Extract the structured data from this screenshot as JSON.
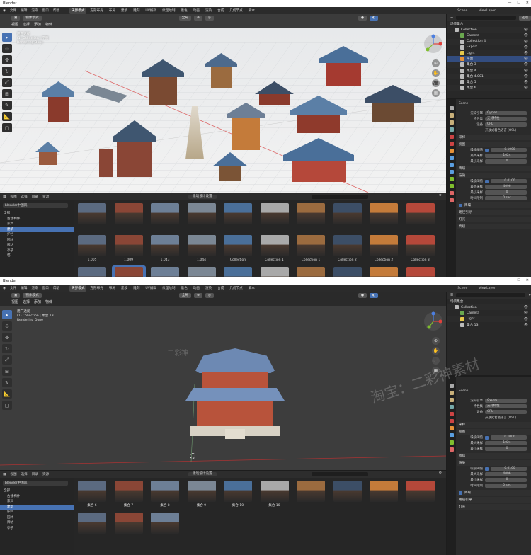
{
  "app_title": "Blender",
  "menu": [
    "文件",
    "编辑",
    "渲染",
    "窗口",
    "帮助"
  ],
  "workspaces_top": [
    "天界模式",
    "方形布光",
    "布局",
    "建模",
    "雕刻",
    "UV编辑",
    "纹理绘制",
    "着色",
    "动画",
    "渲染",
    "合成",
    "几何节点",
    "脚本"
  ],
  "workspaces_bottom": [
    "天界模式",
    "方形布光",
    "布局",
    "建模",
    "雕刻",
    "UV编辑",
    "纹理绘制",
    "着色",
    "动画",
    "渲染",
    "合成",
    "几何节点",
    "脚本"
  ],
  "scene_label": "Scene",
  "viewlayer_label": "ViewLayer",
  "view_header": {
    "mode": "物体模式",
    "menus": [
      "视图",
      "选择",
      "添加",
      "物体"
    ],
    "transform": "全局"
  },
  "top_overlay": {
    "line1": "用户透视",
    "line2": "(1) Collection | 平面",
    "line3": "Rendering Done"
  },
  "bottom_overlay": {
    "line1": "用户透视",
    "line2": "(1) Collection | 集合 13",
    "line3": "Rendering Done"
  },
  "outliner_top": {
    "header": "场景集合",
    "filter": "选项",
    "items": [
      {
        "name": "Collection",
        "color": "#bbb"
      },
      {
        "name": "Camera",
        "color": "#6aa84f"
      },
      {
        "name": "Collection 4",
        "color": "#bbb"
      },
      {
        "name": "Export",
        "color": "#bbb"
      },
      {
        "name": "Light",
        "color": "#e6c84b"
      },
      {
        "name": "平面",
        "color": "#e69138",
        "selected": true
      },
      {
        "name": "集合 3",
        "color": "#bbb"
      },
      {
        "name": "集合 4",
        "color": "#bbb"
      },
      {
        "name": "集合 4.001",
        "color": "#bbb"
      },
      {
        "name": "集合 5",
        "color": "#bbb"
      },
      {
        "name": "集合 6",
        "color": "#bbb"
      }
    ]
  },
  "outliner_bottom": {
    "header": "场景集合",
    "items": [
      {
        "name": "Collection",
        "color": "#bbb"
      },
      {
        "name": "Camera",
        "color": "#6aa84f"
      },
      {
        "name": "Light",
        "color": "#e6c84b"
      },
      {
        "name": "集合 13",
        "color": "#bbb"
      }
    ]
  },
  "props_top": {
    "scene": "Scene",
    "render_engine_label": "渲染引擎",
    "render_engine": "Cycles",
    "feature_label": "特性集",
    "feature": "支持特性",
    "device_label": "设备",
    "device": "CPU",
    "osl": "开放式着色语言 (OSL)",
    "sampling": "采样",
    "viewport": "视图",
    "noise_threshold_label": "噪波阈值",
    "noise_threshold": "0.1000",
    "max_samples_label": "最大采样",
    "max_samples": "1024",
    "min_samples_label": "最小采样",
    "min_samples": "0",
    "denoise": "降噪",
    "render": "渲染",
    "r_noise_threshold": "0.0100",
    "r_max_samples": "4096",
    "r_min_samples": "0",
    "time_limit_label": "时间限制",
    "time_limit": "0 sec",
    "denoise2": "降噪",
    "path_guiding": "路径引导",
    "lights": "灯光",
    "advanced": "高级"
  },
  "props_bottom": {
    "scene": "Scene",
    "render_engine_label": "渲染引擎",
    "render_engine": "Cycles",
    "feature_label": "特性集",
    "feature": "支持特性",
    "device_label": "设备",
    "device": "CPU",
    "osl": "开放式着色语言 (OSL)",
    "sampling": "采样",
    "viewport": "视图",
    "noise_threshold_label": "噪波阈值",
    "noise_threshold": "0.1000",
    "max_samples_label": "最大采样",
    "max_samples": "1024",
    "min_samples_label": "最小采样",
    "min_samples": "0",
    "denoise": "降噪",
    "render": "渲染",
    "r_noise_threshold": "0.0100",
    "r_max_samples": "4096",
    "r_min_samples": "0",
    "time_limit_label": "时间限制",
    "time_limit": "0 sec",
    "denoise2": "降噪",
    "path_guiding": "路径引导",
    "lights": "灯光"
  },
  "asset_browser": {
    "menus": [
      "视图",
      "选择",
      "目录",
      "资源"
    ],
    "catalog": "建筑设计设置",
    "library": "blender中国风",
    "categories_top": [
      "全部",
      "古建构件",
      "家具",
      "建筑",
      "护栏",
      "园林",
      "牌坊",
      "亭子",
      "塔"
    ],
    "categories_bottom": [
      "全部",
      "古建构件",
      "家具",
      "建筑",
      "护栏",
      "园林",
      "牌坊",
      "亭子"
    ],
    "assets_top": [
      "",
      "",
      "",
      "",
      "",
      "",
      "",
      "",
      "",
      "",
      "1.005",
      "1.009",
      "1.043",
      "1.044",
      "Collection",
      "Collection 1",
      "Collection 1",
      "Collection 2",
      "Collection 2",
      "Collection 3",
      "Collection 3",
      "Collection 4",
      "Collection 5",
      "Collection 9",
      "Export",
      "Export",
      "Export",
      "Japanese Temple ...",
      "四角",
      "集合 2"
    ],
    "assets_bottom": [
      "集合 6",
      "集合 7",
      "集合 8",
      "集合 9",
      "集合 10",
      "集合 10",
      "",
      "",
      "",
      "",
      "",
      "",
      ""
    ]
  },
  "watermark_text": "淘宝：二彩神素材",
  "watermark_logo": "二彩神"
}
